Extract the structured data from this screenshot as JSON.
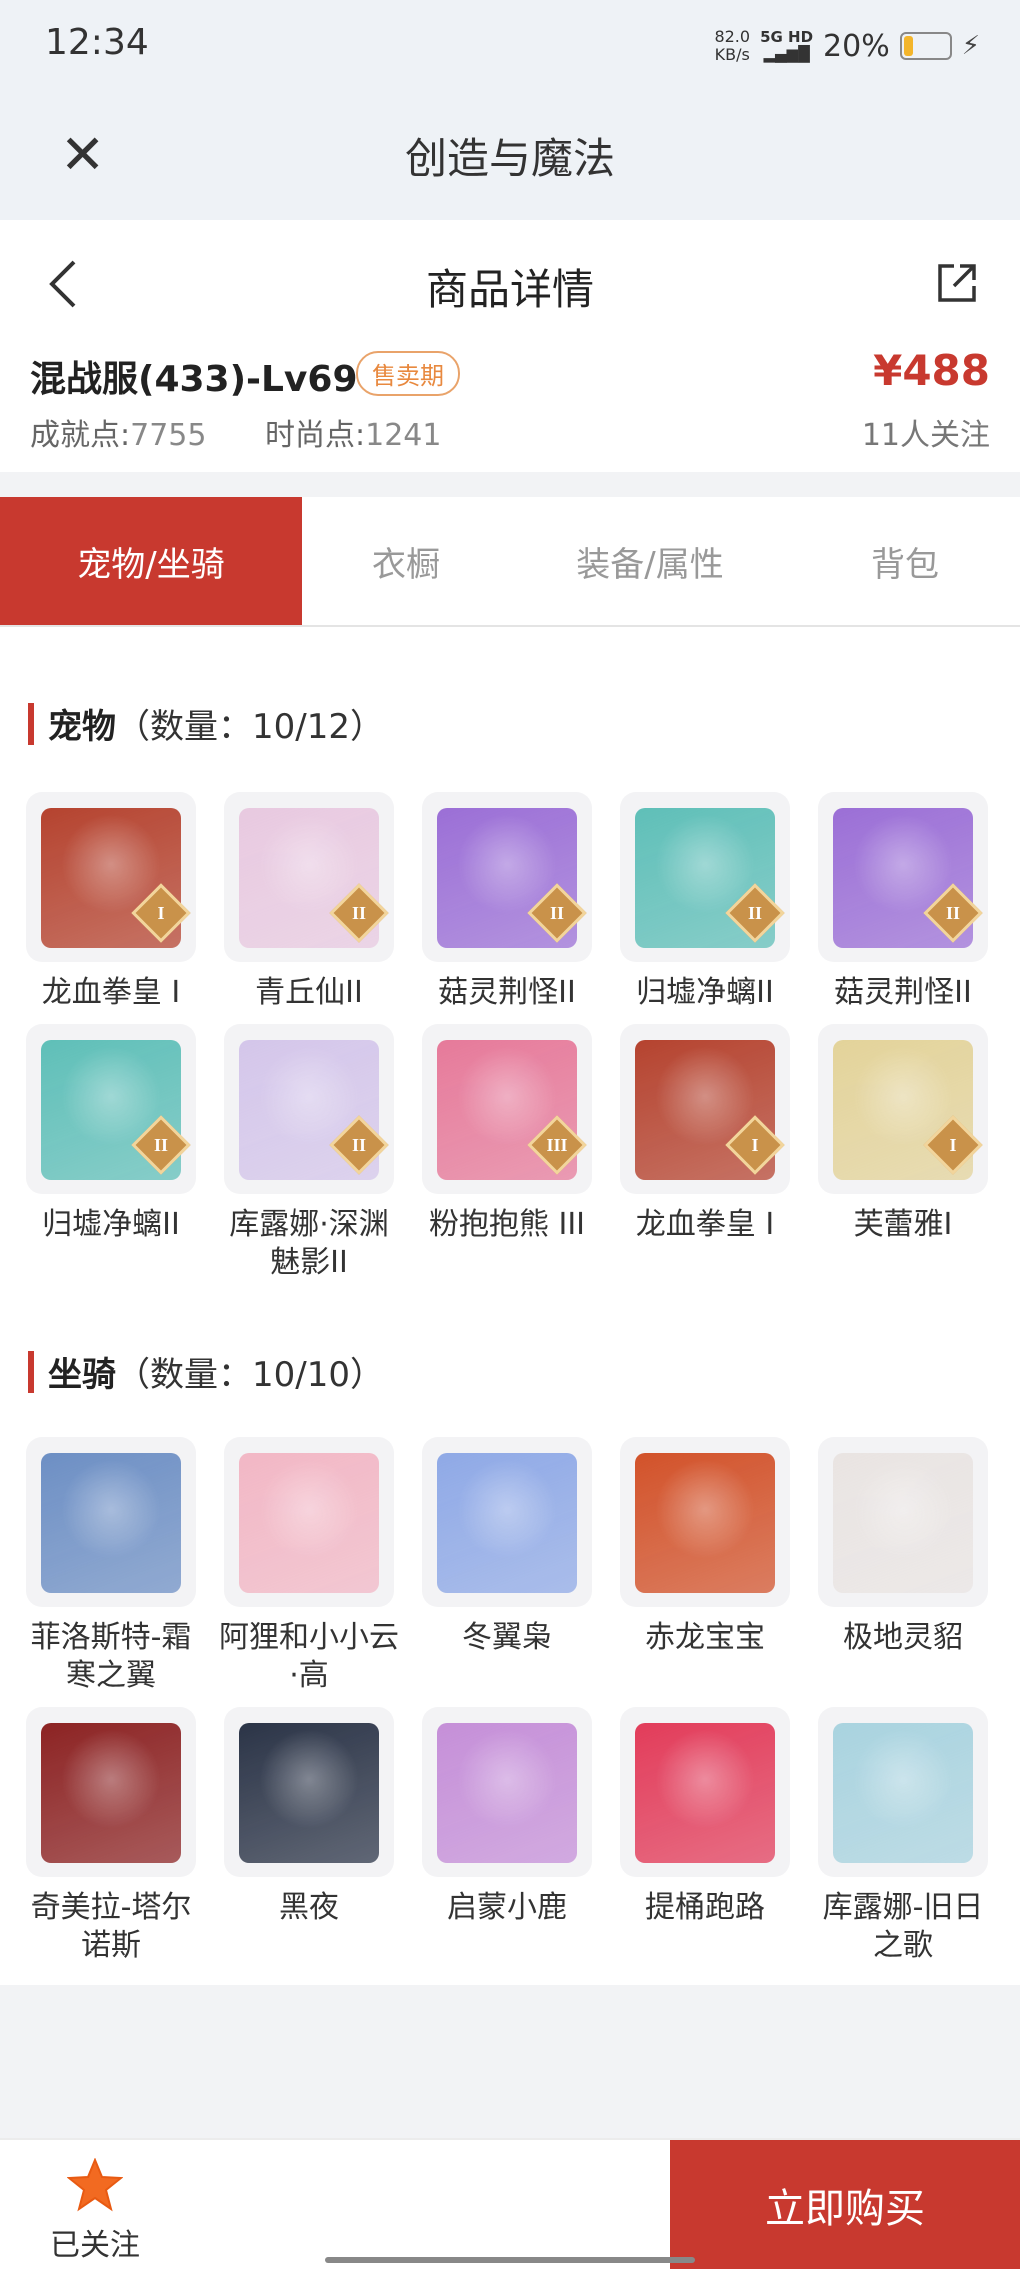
{
  "status_bar": {
    "time": "12:34",
    "speed": "82.0",
    "speed_unit": "KB/s",
    "network": "5G HD",
    "battery": "20%",
    "battery_level": 0.2
  },
  "app": {
    "title": "创造与魔法"
  },
  "page": {
    "title": "商品详情"
  },
  "product": {
    "name": "混战服(433)-Lv69",
    "badge": "售卖期",
    "price": "¥488",
    "achievement_label": "成就点:",
    "achievement_value": "7755",
    "fashion_label": "时尚点:",
    "fashion_value": "1241",
    "followers": "11人关注"
  },
  "tabs": [
    {
      "label": "宠物/坐骑",
      "active": true
    },
    {
      "label": "衣橱",
      "active": false
    },
    {
      "label": "装备/属性",
      "active": false
    },
    {
      "label": "背包",
      "active": false
    }
  ],
  "pets": {
    "title": "宠物",
    "count": "（数量：10/12）",
    "items": [
      {
        "name": "龙血拳皇 I",
        "rank": "I",
        "color": "#b5432f"
      },
      {
        "name": "青丘仙II",
        "rank": "II",
        "color": "#e8c9e0"
      },
      {
        "name": "菇灵荆怪II",
        "rank": "II",
        "color": "#9b6fd6"
      },
      {
        "name": "归墟净螭II",
        "rank": "II",
        "color": "#5fbfb8"
      },
      {
        "name": "菇灵荆怪II",
        "rank": "II",
        "color": "#9b6fd6"
      },
      {
        "name": "归墟净螭II",
        "rank": "II",
        "color": "#5fbfb8"
      },
      {
        "name": "库露娜·深渊魅影II",
        "rank": "II",
        "color": "#d4c6ea"
      },
      {
        "name": "粉抱抱熊 III",
        "rank": "III",
        "color": "#e67a9a"
      },
      {
        "name": "龙血拳皇 I",
        "rank": "I",
        "color": "#b5432f"
      },
      {
        "name": "芙蕾雅I",
        "rank": "I",
        "color": "#e3d39a"
      }
    ]
  },
  "mounts": {
    "title": "坐骑",
    "count": "（数量：10/10）",
    "items": [
      {
        "name": "菲洛斯特-霜寒之翼",
        "color": "#6d8fc4"
      },
      {
        "name": "阿狸和小小云·高",
        "color": "#f2b7c5"
      },
      {
        "name": "冬翼枭",
        "color": "#8fa9e6"
      },
      {
        "name": "赤龙宝宝",
        "color": "#d2522a"
      },
      {
        "name": "极地灵貂",
        "color": "#e9e4e2"
      },
      {
        "name": "奇美拉-塔尔诺斯",
        "color": "#8c2323"
      },
      {
        "name": "黑夜",
        "color": "#2b3447"
      },
      {
        "name": "启蒙小鹿",
        "color": "#c58fd8"
      },
      {
        "name": "提桶跑路",
        "color": "#e23c5a"
      },
      {
        "name": "库露娜-旧日之歌",
        "color": "#a9d3df"
      }
    ]
  },
  "bottom": {
    "follow_label": "已关注",
    "buy_label": "立即购买"
  }
}
